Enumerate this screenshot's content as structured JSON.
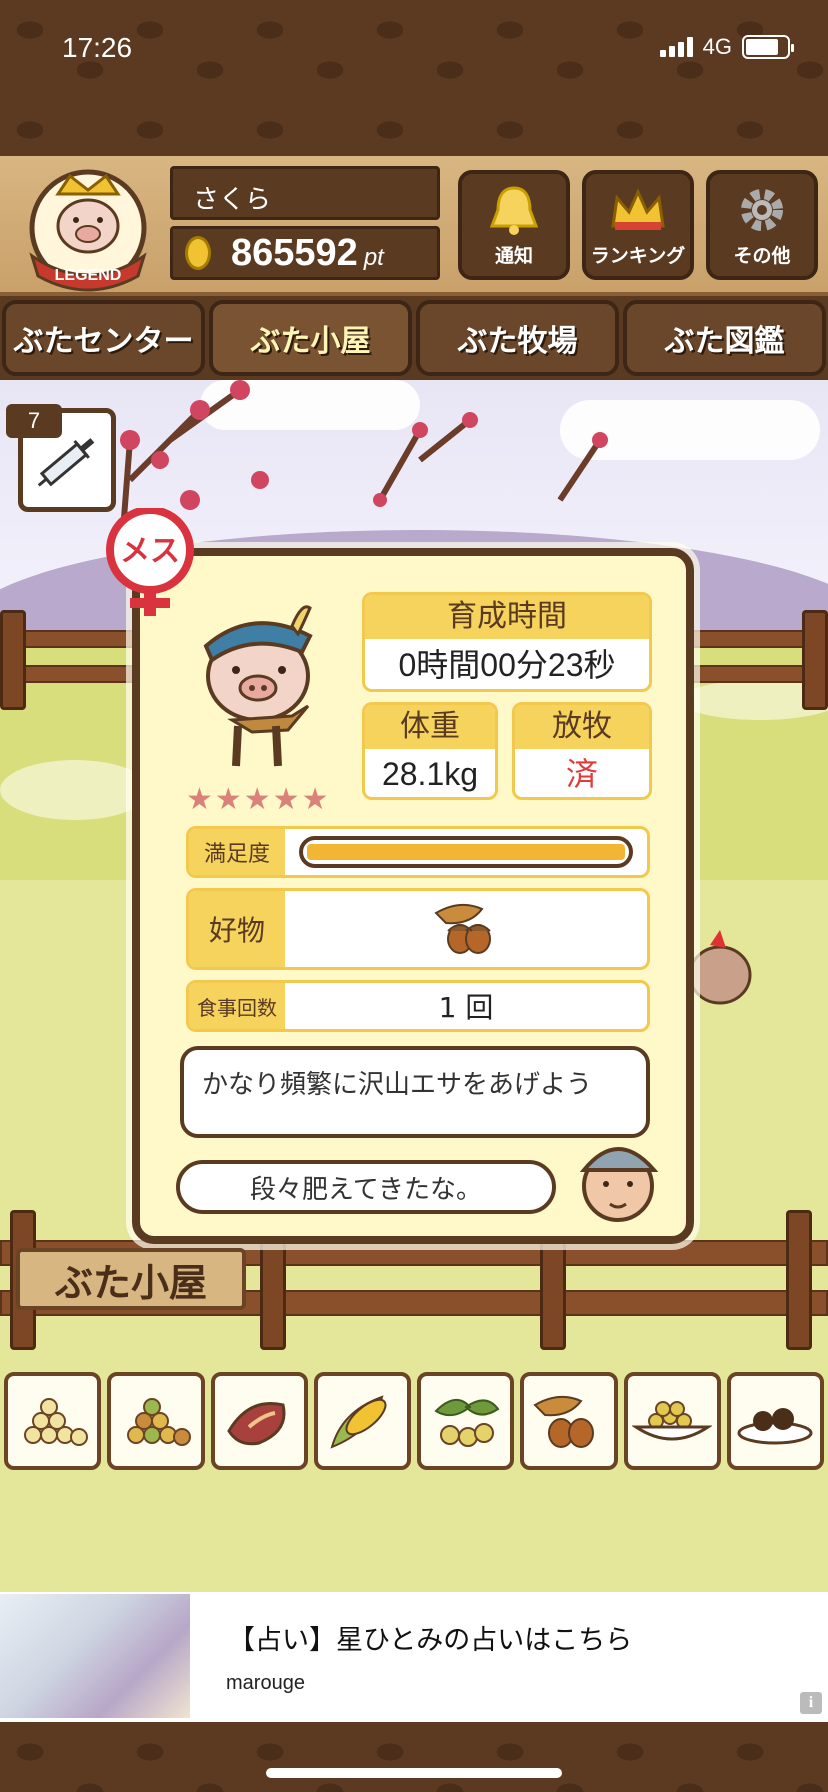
{
  "status_bar": {
    "time": "17:26",
    "network": "4G"
  },
  "header": {
    "emblem_text": "LEGEND",
    "username": "さくら",
    "points": "865592",
    "points_unit": "pt",
    "buttons": [
      {
        "label": "通知",
        "icon": "bell-icon"
      },
      {
        "label": "ランキング",
        "icon": "crown-icon"
      },
      {
        "label": "その他",
        "icon": "gear-icon"
      }
    ]
  },
  "nav_tabs": [
    {
      "label": "ぶたセンター",
      "active": false
    },
    {
      "label": "ぶた小屋",
      "active": true
    },
    {
      "label": "ぶた牧場",
      "active": false
    },
    {
      "label": "ぶた図鑑",
      "active": false
    }
  ],
  "syringe": {
    "count": "7",
    "icon": "syringe-icon"
  },
  "pig_card": {
    "gender_label": "メス",
    "growth_time_label": "育成時間",
    "growth_time_value": "0時間00分23秒",
    "weight_label": "体重",
    "weight_value": "28.1kg",
    "pasture_label": "放牧",
    "pasture_value": "済",
    "stars": "★★★★★",
    "rating": 5,
    "satisfaction_label": "満足度",
    "satisfaction_level": 1.0,
    "favorite_label": "好物",
    "favorite_icon": "acorn-icon",
    "meals_label": "食事回数",
    "meals_value": "1 回",
    "advice": "かなり頻繁に沢山エサをあげよう",
    "farmer_comment": "段々肥えてきたな。"
  },
  "sign_text": "ぶた小屋",
  "foods": [
    "soybeans-icon",
    "mixed-beans-icon",
    "sweet-potato-icon",
    "corn-icon",
    "green-plant-icon",
    "acorn-icon",
    "bean-bowl-icon",
    "truffle-icon"
  ],
  "ad": {
    "title": "【占い】星ひとみの占いはこちら",
    "advertiser": "marouge",
    "info_label": "i"
  },
  "colors": {
    "wood_dark": "#5a3b22",
    "panel_bg": "#fff8c9",
    "accent_yellow": "#f6d35c",
    "red": "#e03a3a"
  }
}
